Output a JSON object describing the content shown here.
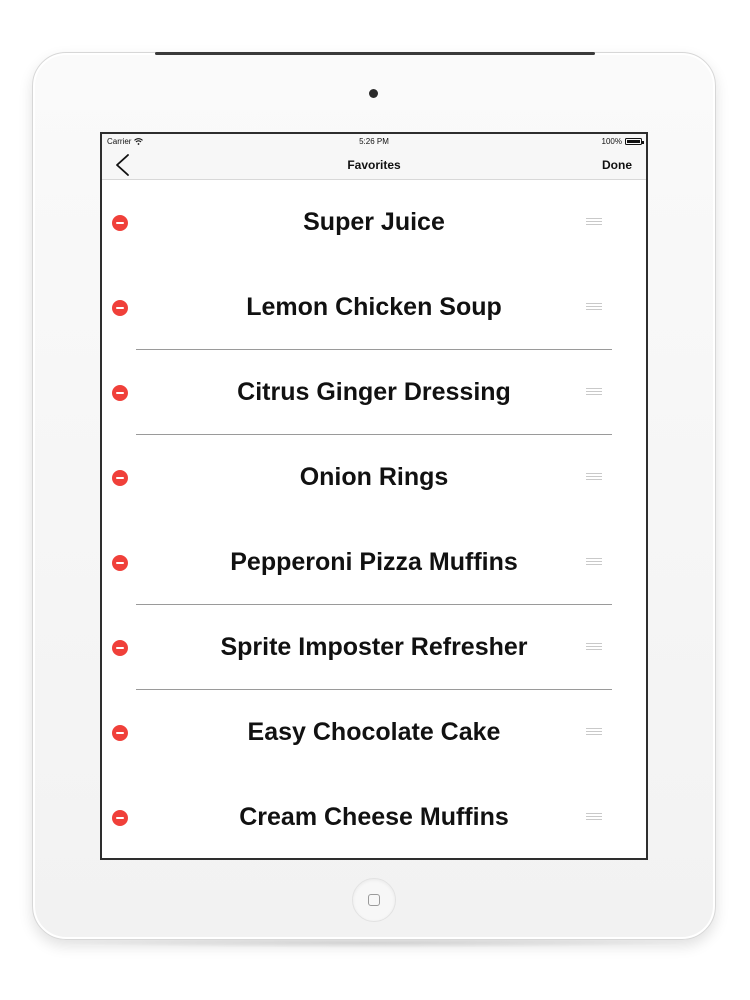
{
  "status_bar": {
    "carrier": "Carrier",
    "time": "5:26 PM",
    "battery": "100%",
    "battery_level": 1.0
  },
  "nav": {
    "title": "Favorites",
    "done_label": "Done",
    "back_icon": "chevron-left-icon"
  },
  "favorites": [
    {
      "title": "Super Juice",
      "separator": false
    },
    {
      "title": "Lemon Chicken Soup",
      "separator": true
    },
    {
      "title": "Citrus Ginger Dressing",
      "separator": true
    },
    {
      "title": "Onion Rings",
      "separator": false
    },
    {
      "title": "Pepperoni Pizza Muffins",
      "separator": true
    },
    {
      "title": "Sprite Imposter Refresher",
      "separator": true
    },
    {
      "title": "Easy Chocolate Cake",
      "separator": false
    },
    {
      "title": "Cream Cheese Muffins",
      "separator": false
    }
  ],
  "colors": {
    "delete_red": "#f0403a",
    "text": "#111111",
    "separator": "#9a9a9a"
  }
}
